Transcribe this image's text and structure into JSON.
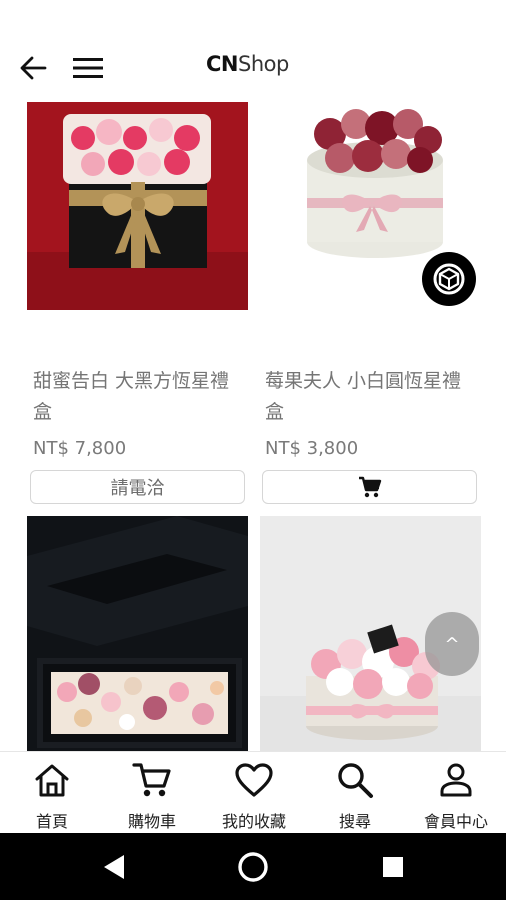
{
  "app": {
    "logo_bold": "CN",
    "logo_light": "Shop"
  },
  "products": [
    {
      "title": "甜蜜告白 大黑方恆星禮盒",
      "price": "NT$ 7,800",
      "action": "請電洽",
      "action_type": "text"
    },
    {
      "title": "莓果夫人 小白圓恆星禮盒",
      "price": "NT$ 3,800",
      "action": "cart-icon",
      "action_type": "icon"
    },
    {
      "title": "",
      "price": "",
      "action": "",
      "action_type": ""
    },
    {
      "title": "",
      "price": "",
      "action": "",
      "action_type": ""
    }
  ],
  "scroll_top": {
    "label": "^"
  },
  "bottom_nav": {
    "items": [
      {
        "label": "首頁",
        "icon": "home-icon"
      },
      {
        "label": "購物車",
        "icon": "cart-icon"
      },
      {
        "label": "我的收藏",
        "icon": "heart-icon"
      },
      {
        "label": "搜尋",
        "icon": "search-icon"
      },
      {
        "label": "會員中心",
        "icon": "person-icon"
      }
    ]
  },
  "colors": {
    "accent": "#111111",
    "text_muted": "#757575",
    "button_border": "#d6d6d6",
    "system_bar": "#000000"
  }
}
